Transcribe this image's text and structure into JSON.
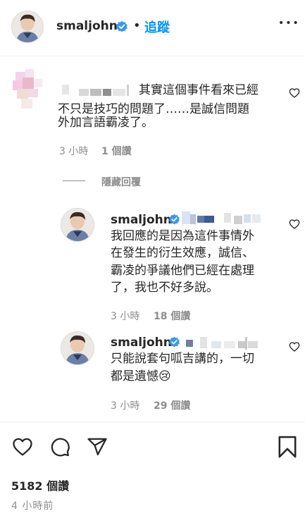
{
  "header": {
    "username": "smaljohn",
    "separator": "•",
    "follow_label": "追蹤",
    "more_label": "•••"
  },
  "comment": {
    "text_line1": "其實這個事件看來已經",
    "text_line2": "不只是技巧的問題了……是誠信問題",
    "text_line3": "外加言語霸凌了。",
    "time": "3 小時",
    "likes": "1 個讚"
  },
  "hide_replies_label": "隱藏回覆",
  "replies": [
    {
      "username": "smaljohn",
      "line1": "我回應的是因為這件事情外",
      "line2": "在發生的衍生效應，誠信、",
      "line3": "霸凌的爭議他們已經在處理",
      "line4": "了，我也不好多說。",
      "time": "3 小時",
      "likes": "18 個讚"
    },
    {
      "username": "smaljohn",
      "line1": "只能說套句呱吉講的，一切",
      "line2": "都是遺憾",
      "emoji": "😢",
      "time": "3 小時",
      "likes": "29 個讚"
    }
  ],
  "post_footer": {
    "likes": "5182 個讚",
    "time": "4 小時前"
  },
  "colors": {
    "accent": "#0095f6",
    "verified": "#3897f0",
    "secondary_text": "#8e8e8e",
    "primary_text": "#262626"
  },
  "icons": [
    "verified-badge-icon",
    "heart-icon",
    "comment-icon",
    "share-icon",
    "bookmark-icon",
    "more-icon"
  ]
}
